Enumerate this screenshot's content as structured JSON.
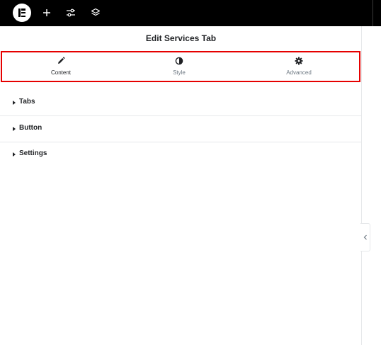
{
  "topbar": {
    "icons": [
      "elementor-logo-icon",
      "plus-icon",
      "sliders-icon",
      "layers-icon"
    ]
  },
  "panel": {
    "title": "Edit Services Tab"
  },
  "tabs": [
    {
      "label": "Content",
      "icon": "pencil-icon",
      "active": true
    },
    {
      "label": "Style",
      "icon": "half-circle-icon",
      "active": false
    },
    {
      "label": "Advanced",
      "icon": "gear-icon",
      "active": false
    }
  ],
  "sections": [
    {
      "title": "Tabs"
    },
    {
      "title": "Button"
    },
    {
      "title": "Settings"
    }
  ],
  "colors": {
    "topbar": "#000000",
    "highlight": "#e60000",
    "text": "#1f2124",
    "muted": "#6d7882",
    "divider": "#e6e8ea"
  }
}
